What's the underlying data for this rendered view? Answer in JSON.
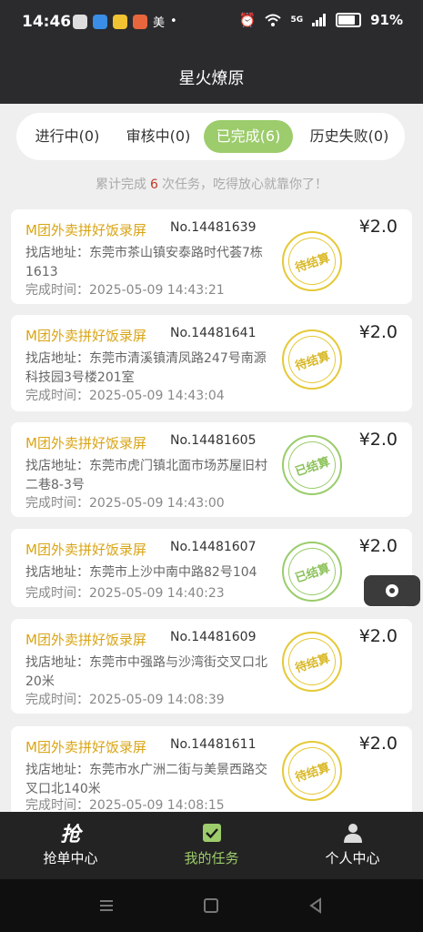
{
  "status_bar": {
    "time": "14:46",
    "app_label": "美",
    "network": "5G",
    "battery": "91%"
  },
  "header": {
    "title": "星火燎原"
  },
  "tabs": [
    {
      "label": "进行中(0)"
    },
    {
      "label": "审核中(0)"
    },
    {
      "label": "已完成(6)"
    },
    {
      "label": "历史失败(0)"
    }
  ],
  "summary": {
    "prefix": "累计完成",
    "count": "6",
    "suffix": "次任务，吃得放心就靠你了！"
  },
  "orders": [
    {
      "name": "M团外卖拼好饭录屏",
      "no": "No.14481639",
      "price": "¥2.0",
      "address": "找店地址：东莞市茶山镇安泰路时代荟7栋1613",
      "time": "完成时间：2025-05-09 14:43:21",
      "stamp": "待结算"
    },
    {
      "name": "M团外卖拼好饭录屏",
      "no": "No.14481641",
      "price": "¥2.0",
      "address": "找店地址：东莞市清溪镇清凤路247号南源科技园3号楼201室",
      "time": "完成时间：2025-05-09 14:43:04",
      "stamp": "待结算"
    },
    {
      "name": "M团外卖拼好饭录屏",
      "no": "No.14481605",
      "price": "¥2.0",
      "address": "找店地址：东莞市虎门镇北面市场苏屋旧村二巷8-3号",
      "time": "完成时间：2025-05-09 14:43:00",
      "stamp": "已结算"
    },
    {
      "name": "M团外卖拼好饭录屏",
      "no": "No.14481607",
      "price": "¥2.0",
      "address": "找店地址：东莞市上沙中南中路82号104",
      "time": "完成时间：2025-05-09 14:40:23",
      "stamp": "已结算"
    },
    {
      "name": "M团外卖拼好饭录屏",
      "no": "No.14481609",
      "price": "¥2.0",
      "address": "找店地址：东莞市中强路与沙湾街交叉口北20米",
      "time": "完成时间：2025-05-09 14:08:39",
      "stamp": "待结算"
    },
    {
      "name": "M团外卖拼好饭录屏",
      "no": "No.14481611",
      "price": "¥2.0",
      "address": "找店地址：东莞市水广洲二街与美景西路交叉口北140米",
      "time": "完成时间：2025-05-09 14:08:15",
      "stamp": "待结算"
    }
  ],
  "bottom_nav": [
    {
      "label": "抢单中心",
      "icon": "grab-icon"
    },
    {
      "label": "我的任务",
      "icon": "check-icon"
    },
    {
      "label": "个人中心",
      "icon": "person-icon"
    }
  ],
  "colors": {
    "accent": "#9ccc6b",
    "pending": "#e5c938",
    "name": "#d9a516",
    "dark": "#2b2b2d"
  }
}
